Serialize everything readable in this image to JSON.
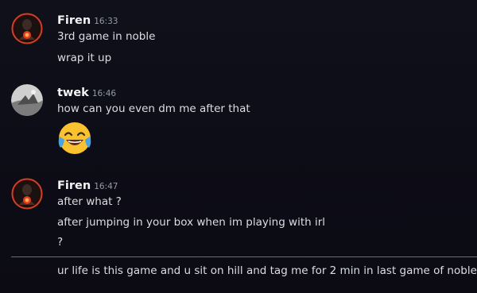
{
  "messages": [
    {
      "author": "Firen",
      "time": "16:33",
      "avatar_icon": "red-flame-avatar",
      "lines": [
        "3rd game in noble",
        "wrap it up"
      ]
    },
    {
      "author": "twek",
      "time": "16:46",
      "avatar_icon": "grey-photo-avatar",
      "lines": [
        "how can you even dm me after that"
      ],
      "emoji": "joy-emoji"
    },
    {
      "author": "Firen",
      "time": "16:47",
      "avatar_icon": "red-flame-avatar",
      "lines": [
        "after what ?",
        "after jumping in your box when im playing with irl",
        "?"
      ]
    }
  ],
  "continued_message": "ur life is this game and u sit on hill and tag me for 2 min in last game of noble",
  "colors": {
    "background": "#0e0e18",
    "username": "#f2f3f5",
    "timestamp": "#949ba4",
    "text": "#dbdee1",
    "new_messages_divider": "#d83c3e"
  }
}
